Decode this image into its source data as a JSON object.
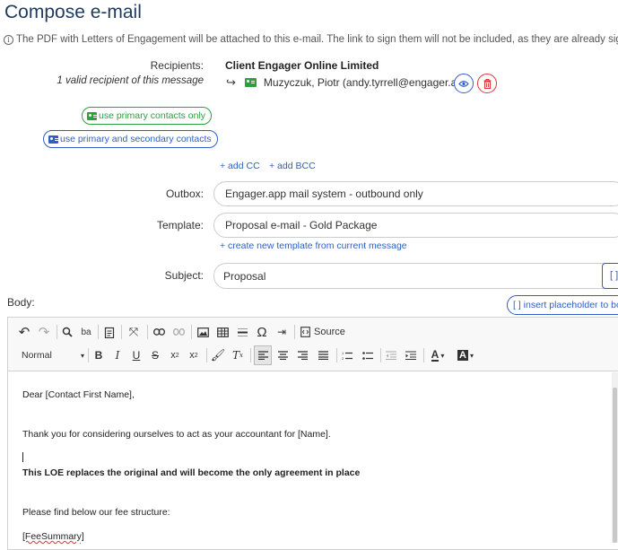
{
  "page": {
    "title": "Compose e-mail",
    "info": "The PDF with Letters of Engagement will be attached to this e-mail. The link to sign them will not be included, as they are already signed."
  },
  "recipients": {
    "label": "Recipients:",
    "count_text": "1 valid recipient of this message",
    "company": "Client Engager Online Limited",
    "contact": "Muzyczuk, Piotr (andy.tyrrell@engager.app)"
  },
  "buttons": {
    "primary_only": "use primary contacts only",
    "primary_secondary": "use primary and secondary contacts",
    "add_cc": "+ add CC",
    "add_bcc": "+ add BCC",
    "new_template": "+ create new template from current message",
    "insert_placeholder": "[ ] insert placeholder to bod",
    "subject_placeholder": "[ ]"
  },
  "fields": {
    "outbox_label": "Outbox:",
    "outbox_value": "Engager.app mail system - outbound only",
    "template_label": "Template:",
    "template_value": "Proposal e-mail - Gold Package",
    "subject_label": "Subject:",
    "subject_value": "Proposal",
    "body_label": "Body:"
  },
  "toolbar": {
    "source_label": "Source",
    "format_value": "Normal"
  },
  "body": {
    "line1": "Dear [Contact First Name],",
    "line2": "Thank you for considering ourselves to act as your accountant for [Name].",
    "line3": "This LOE replaces the original and will become the only agreement in place",
    "line4": "Please find below our fee structure:",
    "line5": "[FeeSummary]"
  },
  "colors": {
    "accent_blue": "#2f5ec4",
    "accent_green": "#2e9e3e",
    "danger_red": "#dd3333",
    "title": "#1f3a5f"
  }
}
